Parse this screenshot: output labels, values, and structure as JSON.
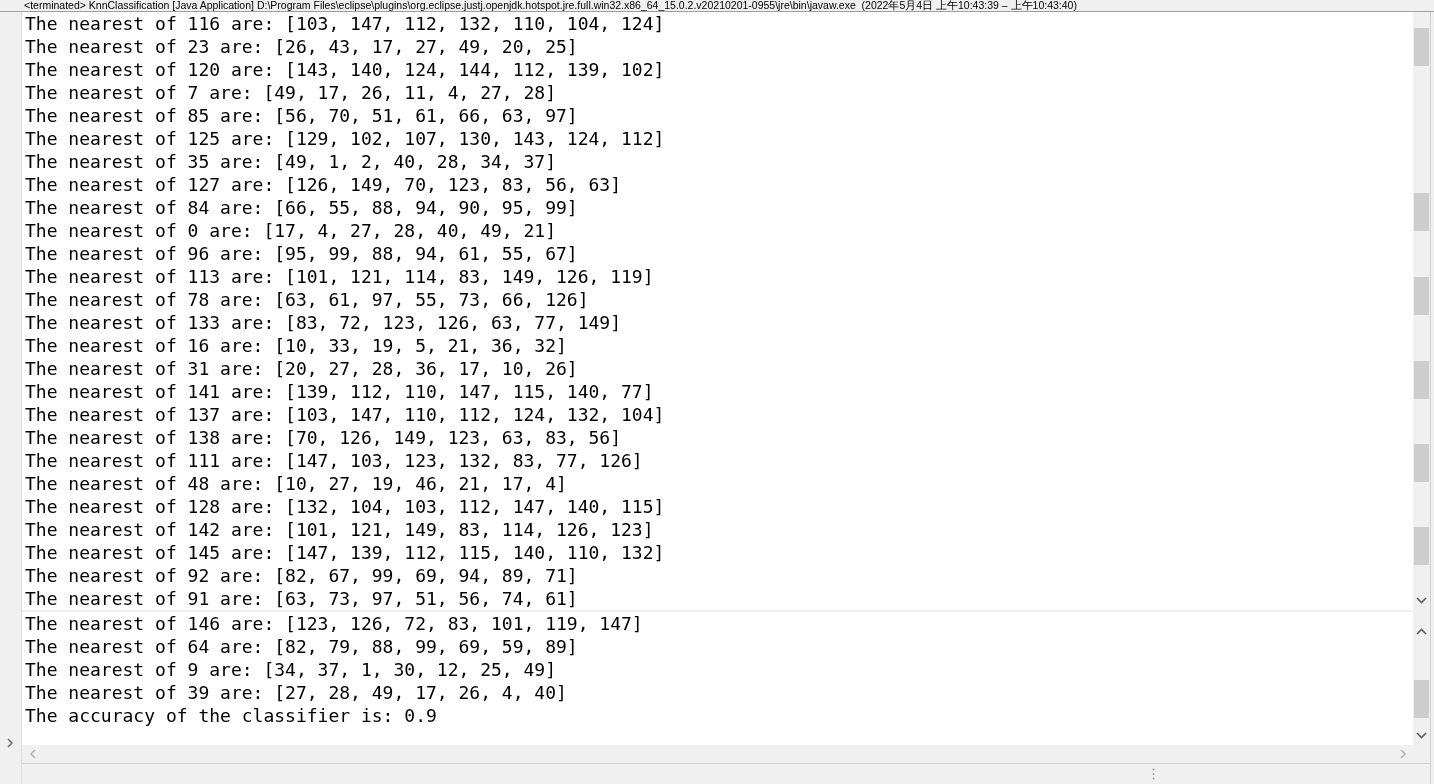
{
  "status_line": "<terminated> KnnClassification [Java Application] D:\\Program Files\\eclipse\\plugins\\org.eclipse.justj.openjdk.hotspot.jre.full.win32.x86_64_15.0.2.v20210201-0955\\jre\\bin\\javaw.exe  (2022年5月4日 上午10:43:39 – 上午10:43:40)",
  "console": {
    "lines": [
      "The nearest of 116 are: [103, 147, 112, 132, 110, 104, 124]",
      "The nearest of 23 are: [26, 43, 17, 27, 49, 20, 25]",
      "The nearest of 120 are: [143, 140, 124, 144, 112, 139, 102]",
      "The nearest of 7 are: [49, 17, 26, 11, 4, 27, 28]",
      "The nearest of 85 are: [56, 70, 51, 61, 66, 63, 97]",
      "The nearest of 125 are: [129, 102, 107, 130, 143, 124, 112]",
      "The nearest of 35 are: [49, 1, 2, 40, 28, 34, 37]",
      "The nearest of 127 are: [126, 149, 70, 123, 83, 56, 63]",
      "The nearest of 84 are: [66, 55, 88, 94, 90, 95, 99]",
      "The nearest of 0 are: [17, 4, 27, 28, 40, 49, 21]",
      "The nearest of 96 are: [95, 99, 88, 94, 61, 55, 67]",
      "The nearest of 113 are: [101, 121, 114, 83, 149, 126, 119]",
      "The nearest of 78 are: [63, 61, 97, 55, 73, 66, 126]",
      "The nearest of 133 are: [83, 72, 123, 126, 63, 77, 149]",
      "The nearest of 16 are: [10, 33, 19, 5, 21, 36, 32]",
      "The nearest of 31 are: [20, 27, 28, 36, 17, 10, 26]",
      "The nearest of 141 are: [139, 112, 110, 147, 115, 140, 77]",
      "The nearest of 137 are: [103, 147, 110, 112, 124, 132, 104]",
      "The nearest of 138 are: [70, 126, 149, 123, 63, 83, 56]",
      "The nearest of 111 are: [147, 103, 123, 132, 83, 77, 126]",
      "The nearest of 48 are: [10, 27, 19, 46, 21, 17, 4]",
      "The nearest of 128 are: [132, 104, 103, 112, 147, 140, 115]",
      "The nearest of 142 are: [101, 121, 149, 83, 114, 126, 123]",
      "The nearest of 145 are: [147, 139, 112, 115, 140, 110, 132]",
      "The nearest of 92 are: [82, 67, 99, 69, 94, 89, 71]",
      "The nearest of 91 are: [63, 73, 97, 51, 56, 74, 61]"
    ]
  },
  "console_lower": {
    "lines": [
      "The nearest of 146 are: [123, 126, 72, 83, 101, 119, 147]",
      "The nearest of 64 are: [82, 79, 88, 99, 69, 59, 89]",
      "The nearest of 9 are: [34, 37, 1, 30, 12, 25, 49]",
      "The nearest of 39 are: [27, 28, 49, 17, 26, 4, 40]",
      "The accuracy of the classifier is: 0.9"
    ]
  }
}
